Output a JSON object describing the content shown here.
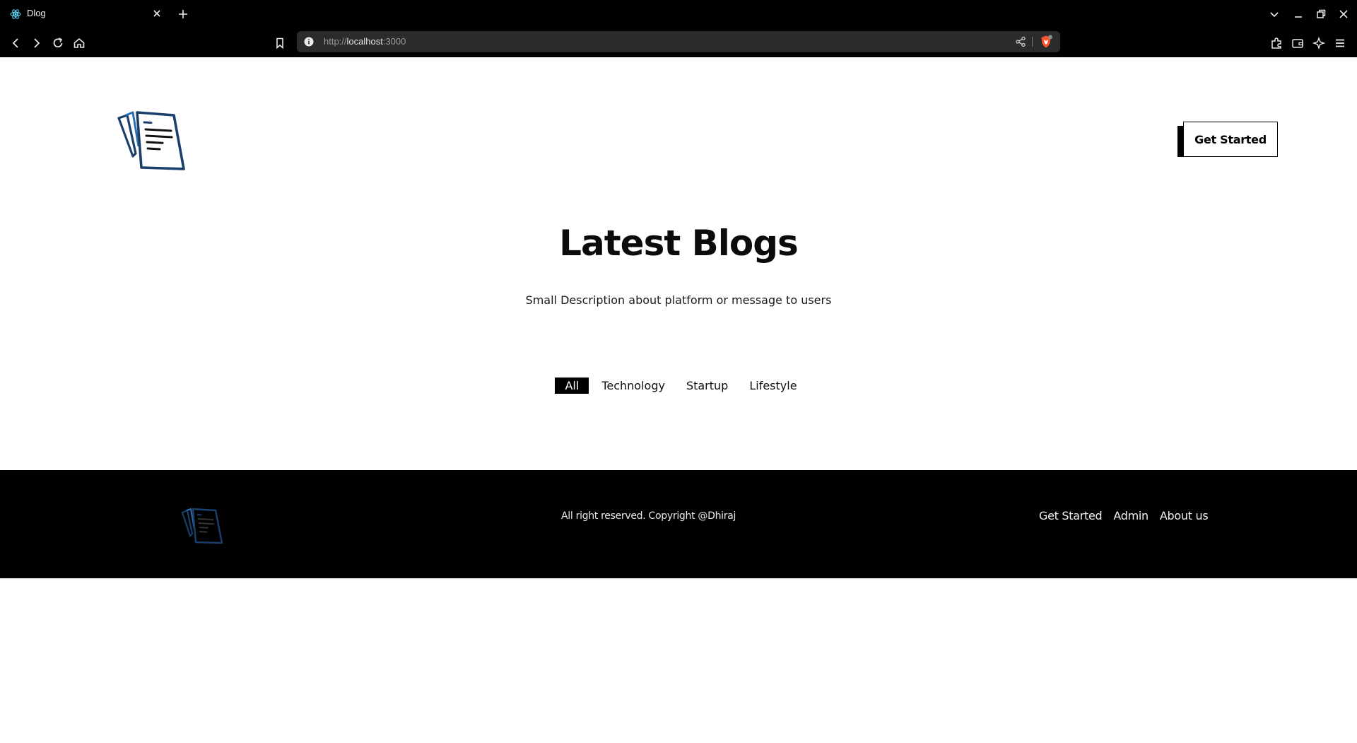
{
  "browser": {
    "tab": {
      "title": "Dlog",
      "favicon": "react-icon"
    },
    "address_bar": {
      "scheme": "http://",
      "host": "localhost",
      "port": ":3000"
    }
  },
  "header": {
    "logo": "document-stack-logo",
    "cta_label": "Get Started"
  },
  "hero": {
    "title": "Latest Blogs",
    "subtitle": "Small Description about platform or message to users"
  },
  "filters": {
    "items": [
      {
        "label": "All",
        "active": true
      },
      {
        "label": "Technology",
        "active": false
      },
      {
        "label": "Startup",
        "active": false
      },
      {
        "label": "Lifestyle",
        "active": false
      }
    ]
  },
  "footer": {
    "copyright": "All right reserved. Copyright @Dhiraj",
    "links": [
      "Get Started",
      "Admin",
      "About us"
    ]
  },
  "colors": {
    "chrome_bg": "#000000",
    "page_bg": "#ffffff",
    "footer_bg": "#000000",
    "logo_blue": "#1a3f6b",
    "active_filter_bg": "#000000"
  }
}
